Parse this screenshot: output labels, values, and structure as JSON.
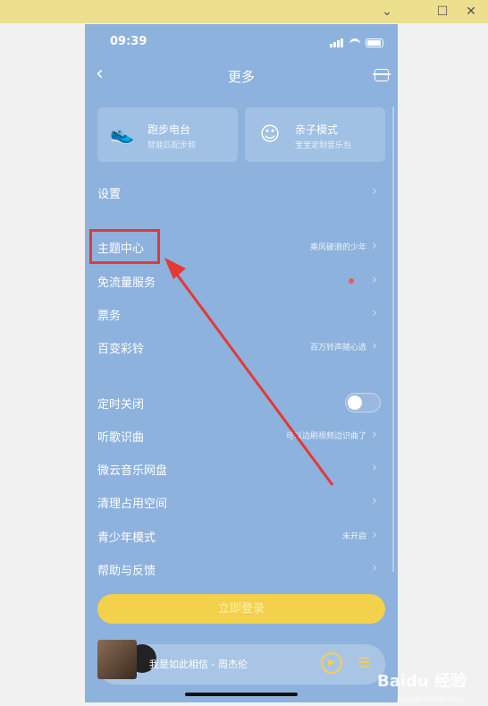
{
  "window": {
    "minimize": "⌄",
    "restore": "☐",
    "close": "✕"
  },
  "status": {
    "time": "09:39"
  },
  "nav": {
    "back": "‹",
    "title": "更多"
  },
  "cards": [
    {
      "icon": "running-shoe-icon",
      "glyph": "👟",
      "title": "跑步电台",
      "subtitle": "智能匹配步频"
    },
    {
      "icon": "baby-face-icon",
      "glyph": "☺",
      "title": "亲子模式",
      "subtitle": "宝宝定制音乐包"
    }
  ],
  "menu": {
    "settings": {
      "label": "设置"
    },
    "theme": {
      "label": "主题中心",
      "value": "乘风破浪的少年"
    },
    "free_data": {
      "label": "免流量服务"
    },
    "tickets": {
      "label": "票务"
    },
    "ringtone": {
      "label": "百变彩铃",
      "value": "百万铃声随心选"
    },
    "timer": {
      "label": "定时关闭"
    },
    "recognize": {
      "label": "听歌识曲",
      "value": "可以边刷视频边识曲了"
    },
    "cloud_disk": {
      "label": "微云音乐网盘"
    },
    "clean": {
      "label": "清理占用空间"
    },
    "teen_mode": {
      "label": "青少年模式",
      "value": "未开启"
    },
    "help": {
      "label": "帮助与反馈"
    }
  },
  "chevron": "›",
  "login": {
    "label": "立即登录"
  },
  "player": {
    "track": "我是如此相信 - 周杰伦",
    "play_glyph": "▶",
    "list_glyph": "☰"
  },
  "watermark": {
    "brand": "Baidu 经验",
    "url": "jingyan.baidu.com"
  },
  "colors": {
    "highlight": "#e53935",
    "accent": "#f3d14a",
    "background": "#8db2dd"
  }
}
